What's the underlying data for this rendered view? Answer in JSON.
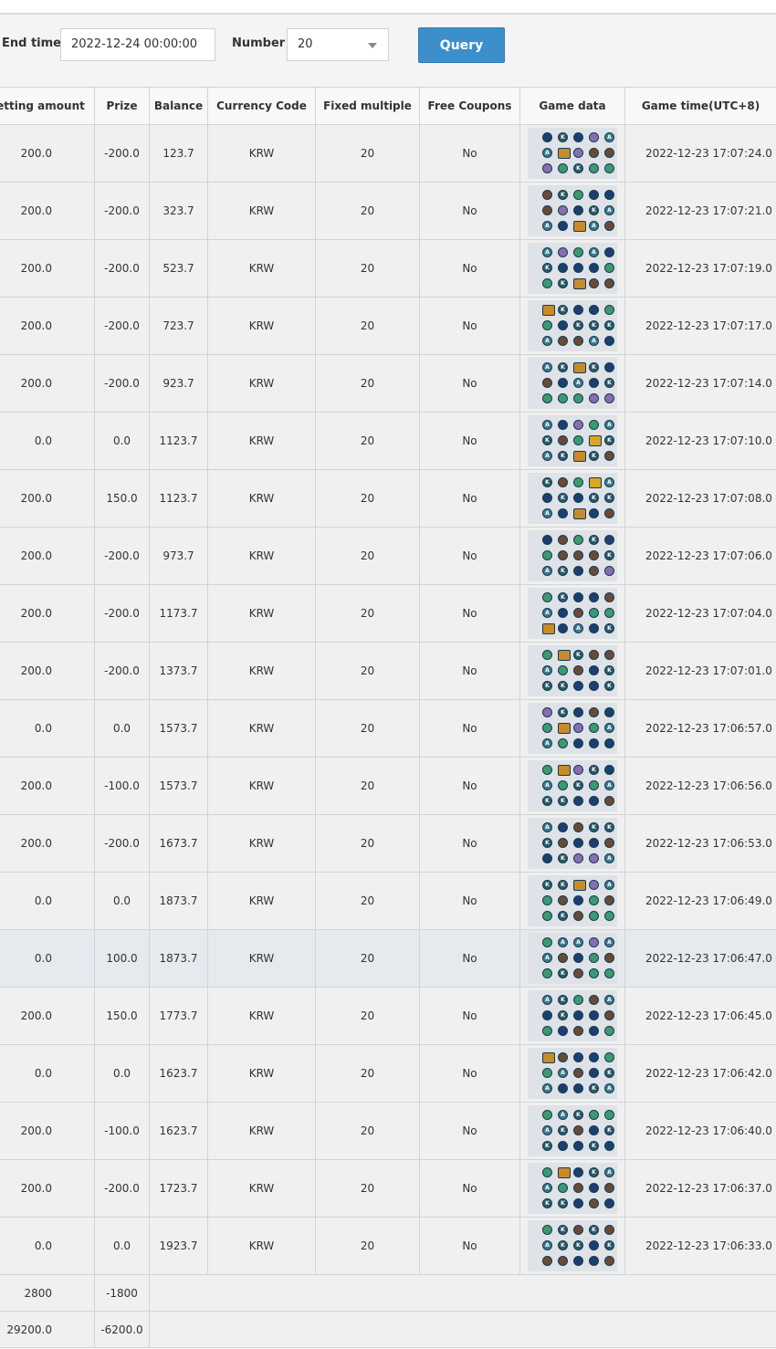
{
  "filter": {
    "end_time_label": "End time",
    "end_time_value": "2022-12-24 00:00:00",
    "number_label": "Number",
    "number_value": "20",
    "query_label": "Query"
  },
  "table": {
    "headers": [
      "Betting amount",
      "Prize",
      "Balance",
      "Currency Code",
      "Fixed multiple",
      "Free Coupons",
      "Game data",
      "Game time(UTC+8)"
    ],
    "rows": [
      {
        "bet": "200.0",
        "prize": "-200.0",
        "balance": "123.7",
        "currency": "KRW",
        "multiple": "20",
        "free": "No",
        "time": "2022-12-23 17:07:24.0",
        "grid": [
          "navy",
          "K",
          "navy",
          "ghost",
          "A",
          "A",
          "monkey",
          "ghost",
          "hair",
          "hair",
          "ghost",
          "green",
          "K",
          "green",
          "green"
        ]
      },
      {
        "bet": "200.0",
        "prize": "-200.0",
        "balance": "323.7",
        "currency": "KRW",
        "multiple": "20",
        "free": "No",
        "time": "2022-12-23 17:07:21.0",
        "grid": [
          "hair",
          "K",
          "green",
          "navy",
          "navy",
          "hair",
          "ghost",
          "navy",
          "K",
          "A",
          "A",
          "navy",
          "monkey",
          "A",
          "hair"
        ]
      },
      {
        "bet": "200.0",
        "prize": "-200.0",
        "balance": "523.7",
        "currency": "KRW",
        "multiple": "20",
        "free": "No",
        "time": "2022-12-23 17:07:19.0",
        "grid": [
          "A",
          "ghost",
          "green",
          "A",
          "navy",
          "K",
          "navy",
          "navy",
          "navy",
          "green",
          "green",
          "K",
          "monkey",
          "hair",
          "hair"
        ]
      },
      {
        "bet": "200.0",
        "prize": "-200.0",
        "balance": "723.7",
        "currency": "KRW",
        "multiple": "20",
        "free": "No",
        "time": "2022-12-23 17:07:17.0",
        "grid": [
          "monkey",
          "K",
          "navy",
          "navy",
          "green",
          "green",
          "navy",
          "K",
          "K",
          "K",
          "A",
          "hair",
          "hair",
          "A",
          "navy"
        ]
      },
      {
        "bet": "200.0",
        "prize": "-200.0",
        "balance": "923.7",
        "currency": "KRW",
        "multiple": "20",
        "free": "No",
        "time": "2022-12-23 17:07:14.0",
        "grid": [
          "A",
          "K",
          "monkey",
          "K",
          "navy",
          "hair",
          "navy",
          "A",
          "navy",
          "K",
          "green",
          "green",
          "green",
          "ghost",
          "ghost"
        ]
      },
      {
        "bet": "0.0",
        "prize": "0.0",
        "balance": "1123.7",
        "currency": "KRW",
        "multiple": "20",
        "free": "No",
        "time": "2022-12-23 17:07:10.0",
        "grid": [
          "A",
          "navy",
          "ghost",
          "green",
          "A",
          "K",
          "hair",
          "green",
          "gold",
          "K",
          "A",
          "K",
          "monkey",
          "K",
          "hair"
        ]
      },
      {
        "bet": "200.0",
        "prize": "150.0",
        "balance": "1123.7",
        "currency": "KRW",
        "multiple": "20",
        "free": "No",
        "time": "2022-12-23 17:07:08.0",
        "grid": [
          "K",
          "hair",
          "green",
          "gold",
          "A",
          "navy",
          "K",
          "navy",
          "K",
          "K",
          "A",
          "navy",
          "monkey",
          "navy",
          "hair"
        ]
      },
      {
        "bet": "200.0",
        "prize": "-200.0",
        "balance": "973.7",
        "currency": "KRW",
        "multiple": "20",
        "free": "No",
        "time": "2022-12-23 17:07:06.0",
        "grid": [
          "navy",
          "hair",
          "green",
          "K",
          "navy",
          "green",
          "hair",
          "hair",
          "hair",
          "K",
          "A",
          "K",
          "navy",
          "hair",
          "ghost"
        ]
      },
      {
        "bet": "200.0",
        "prize": "-200.0",
        "balance": "1173.7",
        "currency": "KRW",
        "multiple": "20",
        "free": "No",
        "time": "2022-12-23 17:07:04.0",
        "grid": [
          "green",
          "K",
          "navy",
          "navy",
          "hair",
          "A",
          "navy",
          "hair",
          "green",
          "green",
          "monkey",
          "navy",
          "A",
          "navy",
          "K"
        ]
      },
      {
        "bet": "200.0",
        "prize": "-200.0",
        "balance": "1373.7",
        "currency": "KRW",
        "multiple": "20",
        "free": "No",
        "time": "2022-12-23 17:07:01.0",
        "grid": [
          "green",
          "monkey",
          "K",
          "hair",
          "hair",
          "A",
          "green",
          "hair",
          "navy",
          "K",
          "K",
          "K",
          "navy",
          "navy",
          "K"
        ]
      },
      {
        "bet": "0.0",
        "prize": "0.0",
        "balance": "1573.7",
        "currency": "KRW",
        "multiple": "20",
        "free": "No",
        "time": "2022-12-23 17:06:57.0",
        "grid": [
          "ghost",
          "K",
          "navy",
          "hair",
          "navy",
          "green",
          "monkey",
          "ghost",
          "green",
          "A",
          "A",
          "green",
          "navy",
          "navy",
          "navy"
        ]
      },
      {
        "bet": "200.0",
        "prize": "-100.0",
        "balance": "1573.7",
        "currency": "KRW",
        "multiple": "20",
        "free": "No",
        "time": "2022-12-23 17:06:56.0",
        "grid": [
          "green",
          "monkey",
          "ghost",
          "K",
          "navy",
          "A",
          "green",
          "K",
          "green",
          "A",
          "K",
          "K",
          "navy",
          "navy",
          "hair"
        ]
      },
      {
        "bet": "200.0",
        "prize": "-200.0",
        "balance": "1673.7",
        "currency": "KRW",
        "multiple": "20",
        "free": "No",
        "time": "2022-12-23 17:06:53.0",
        "grid": [
          "A",
          "navy",
          "hair",
          "K",
          "K",
          "K",
          "hair",
          "navy",
          "navy",
          "hair",
          "navy",
          "K",
          "ghost",
          "ghost",
          "A"
        ]
      },
      {
        "bet": "0.0",
        "prize": "0.0",
        "balance": "1873.7",
        "currency": "KRW",
        "multiple": "20",
        "free": "No",
        "time": "2022-12-23 17:06:49.0",
        "grid": [
          "K",
          "K",
          "monkey",
          "ghost",
          "A",
          "green",
          "hair",
          "navy",
          "green",
          "hair",
          "green",
          "K",
          "hair",
          "green",
          "green"
        ]
      },
      {
        "bet": "0.0",
        "prize": "100.0",
        "balance": "1873.7",
        "currency": "KRW",
        "multiple": "20",
        "free": "No",
        "time": "2022-12-23 17:06:47.0",
        "grid": [
          "green",
          "A",
          "A",
          "ghost",
          "A",
          "A",
          "hair",
          "navy",
          "green",
          "hair",
          "green",
          "K",
          "hair",
          "green",
          "green"
        ],
        "highlight": true
      },
      {
        "bet": "200.0",
        "prize": "150.0",
        "balance": "1773.7",
        "currency": "KRW",
        "multiple": "20",
        "free": "No",
        "time": "2022-12-23 17:06:45.0",
        "grid": [
          "A",
          "K",
          "green",
          "hair",
          "A",
          "navy",
          "K",
          "navy",
          "navy",
          "hair",
          "green",
          "navy",
          "hair",
          "navy",
          "green"
        ]
      },
      {
        "bet": "0.0",
        "prize": "0.0",
        "balance": "1623.7",
        "currency": "KRW",
        "multiple": "20",
        "free": "No",
        "time": "2022-12-23 17:06:42.0",
        "grid": [
          "monkey",
          "hair",
          "navy",
          "navy",
          "green",
          "green",
          "A",
          "hair",
          "navy",
          "K",
          "A",
          "navy",
          "navy",
          "K",
          "A"
        ]
      },
      {
        "bet": "200.0",
        "prize": "-100.0",
        "balance": "1623.7",
        "currency": "KRW",
        "multiple": "20",
        "free": "No",
        "time": "2022-12-23 17:06:40.0",
        "grid": [
          "green",
          "A",
          "K",
          "green",
          "green",
          "A",
          "K",
          "hair",
          "navy",
          "K",
          "K",
          "navy",
          "navy",
          "K",
          "navy"
        ]
      },
      {
        "bet": "200.0",
        "prize": "-200.0",
        "balance": "1723.7",
        "currency": "KRW",
        "multiple": "20",
        "free": "No",
        "time": "2022-12-23 17:06:37.0",
        "grid": [
          "green",
          "monkey",
          "navy",
          "K",
          "A",
          "A",
          "green",
          "hair",
          "navy",
          "hair",
          "K",
          "K",
          "navy",
          "hair",
          "navy"
        ]
      },
      {
        "bet": "0.0",
        "prize": "0.0",
        "balance": "1923.7",
        "currency": "KRW",
        "multiple": "20",
        "free": "No",
        "time": "2022-12-23 17:06:33.0",
        "grid": [
          "green",
          "K",
          "hair",
          "K",
          "hair",
          "A",
          "K",
          "K",
          "navy",
          "K",
          "hair",
          "hair",
          "navy",
          "navy",
          "hair"
        ]
      }
    ],
    "summary": [
      {
        "bet": "2800",
        "prize": "-1800"
      },
      {
        "bet": "29200.0",
        "prize": "-6200.0"
      }
    ]
  },
  "symbol_colors": {
    "navy": "#1d3f6e",
    "K": "#2b5a66",
    "A": "#3d7a8a",
    "green": "#3c9a6e",
    "hair": "#6b4a33",
    "ghost": "#8a6db0",
    "monkey": "#c98a2a",
    "gold": "#d9a623"
  },
  "symbol_letters": {
    "K": "K",
    "A": "A"
  },
  "accent_color": "#3d8fcb"
}
